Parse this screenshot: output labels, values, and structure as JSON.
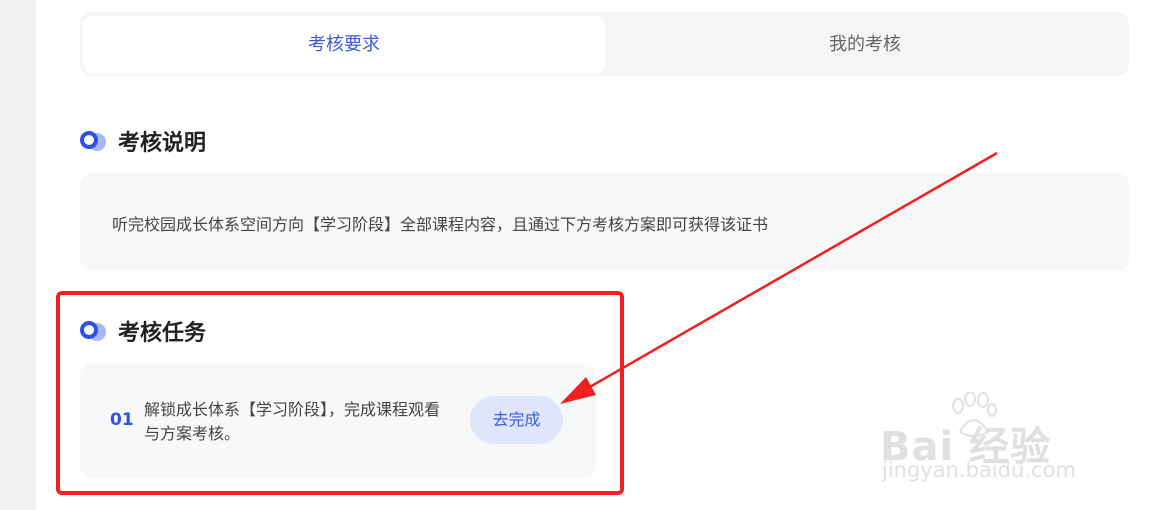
{
  "tabs": [
    {
      "label": "考核要求",
      "active": true
    },
    {
      "label": "我的考核",
      "active": false
    }
  ],
  "section_description": {
    "title": "考核说明",
    "text": "听完校园成长体系空间方向【学习阶段】全部课程内容，且通过下方考核方案即可获得该证书"
  },
  "section_tasks": {
    "title": "考核任务",
    "items": [
      {
        "number": "01",
        "text": "解锁成长体系【学习阶段】，完成课程观看与方案考核。",
        "button_label": "去完成"
      }
    ]
  },
  "watermark": {
    "logo": "Bai 经验",
    "url": "jingyan.baidu.com"
  },
  "colors": {
    "accent": "#2f51e8",
    "annotation": "#f02020"
  }
}
